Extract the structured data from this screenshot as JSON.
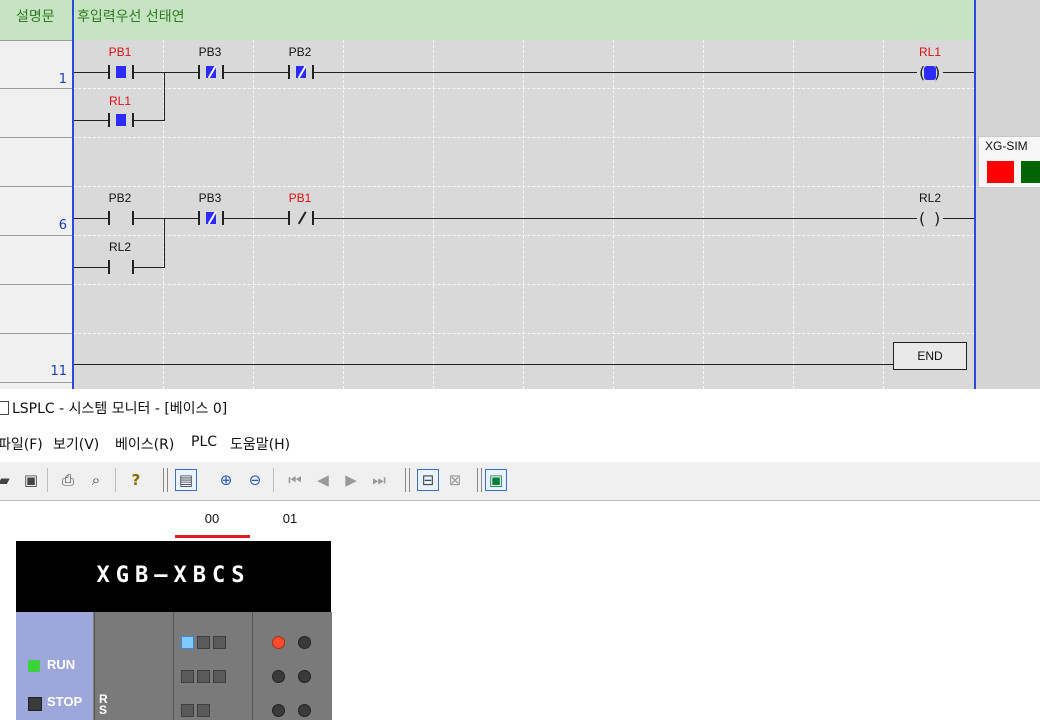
{
  "ladder": {
    "comment_label": "설명문",
    "comment_text": "후입력우선 선태연",
    "row_numbers": [
      "1",
      "6",
      "11"
    ],
    "rung1": {
      "contact1": "PB1",
      "contact1_branch": "RL1",
      "contact2": "PB3",
      "contact3": "PB2",
      "coil": "RL1"
    },
    "rung2": {
      "contact1": "PB2",
      "contact1_branch": "RL2",
      "contact2": "PB3",
      "contact3": "PB1",
      "coil": "RL2"
    },
    "end_label": "END",
    "colors": {
      "energized_label": "#e01010",
      "active_fill": "#2b2bff",
      "rail": "#2a4bd8"
    }
  },
  "xgsim": {
    "title": "XG-SIM",
    "colors": {
      "left": "#ff0000",
      "right": "#006400"
    }
  },
  "monitor": {
    "title": "LSPLC - 시스템 모니터 - [베이스 0]",
    "menu": [
      "파일(F)",
      "보기(V)",
      "베이스(R)",
      "PLC",
      "도움말(H)"
    ],
    "toolbar_icons": [
      "open-icon",
      "save-icon",
      "print-icon",
      "print-preview-icon",
      "help-icon",
      "monitor-icon",
      "zoom-in-icon",
      "zoom-out-icon",
      "first-icon",
      "prev-icon",
      "next-icon",
      "last-icon",
      "connect-icon",
      "disconnect-icon",
      "system-icon"
    ],
    "slots": [
      "00",
      "01"
    ],
    "plc": {
      "model": "XGB—XBCS",
      "run_label": "RUN",
      "stop_label": "STOP",
      "rs_label": "RS"
    }
  }
}
